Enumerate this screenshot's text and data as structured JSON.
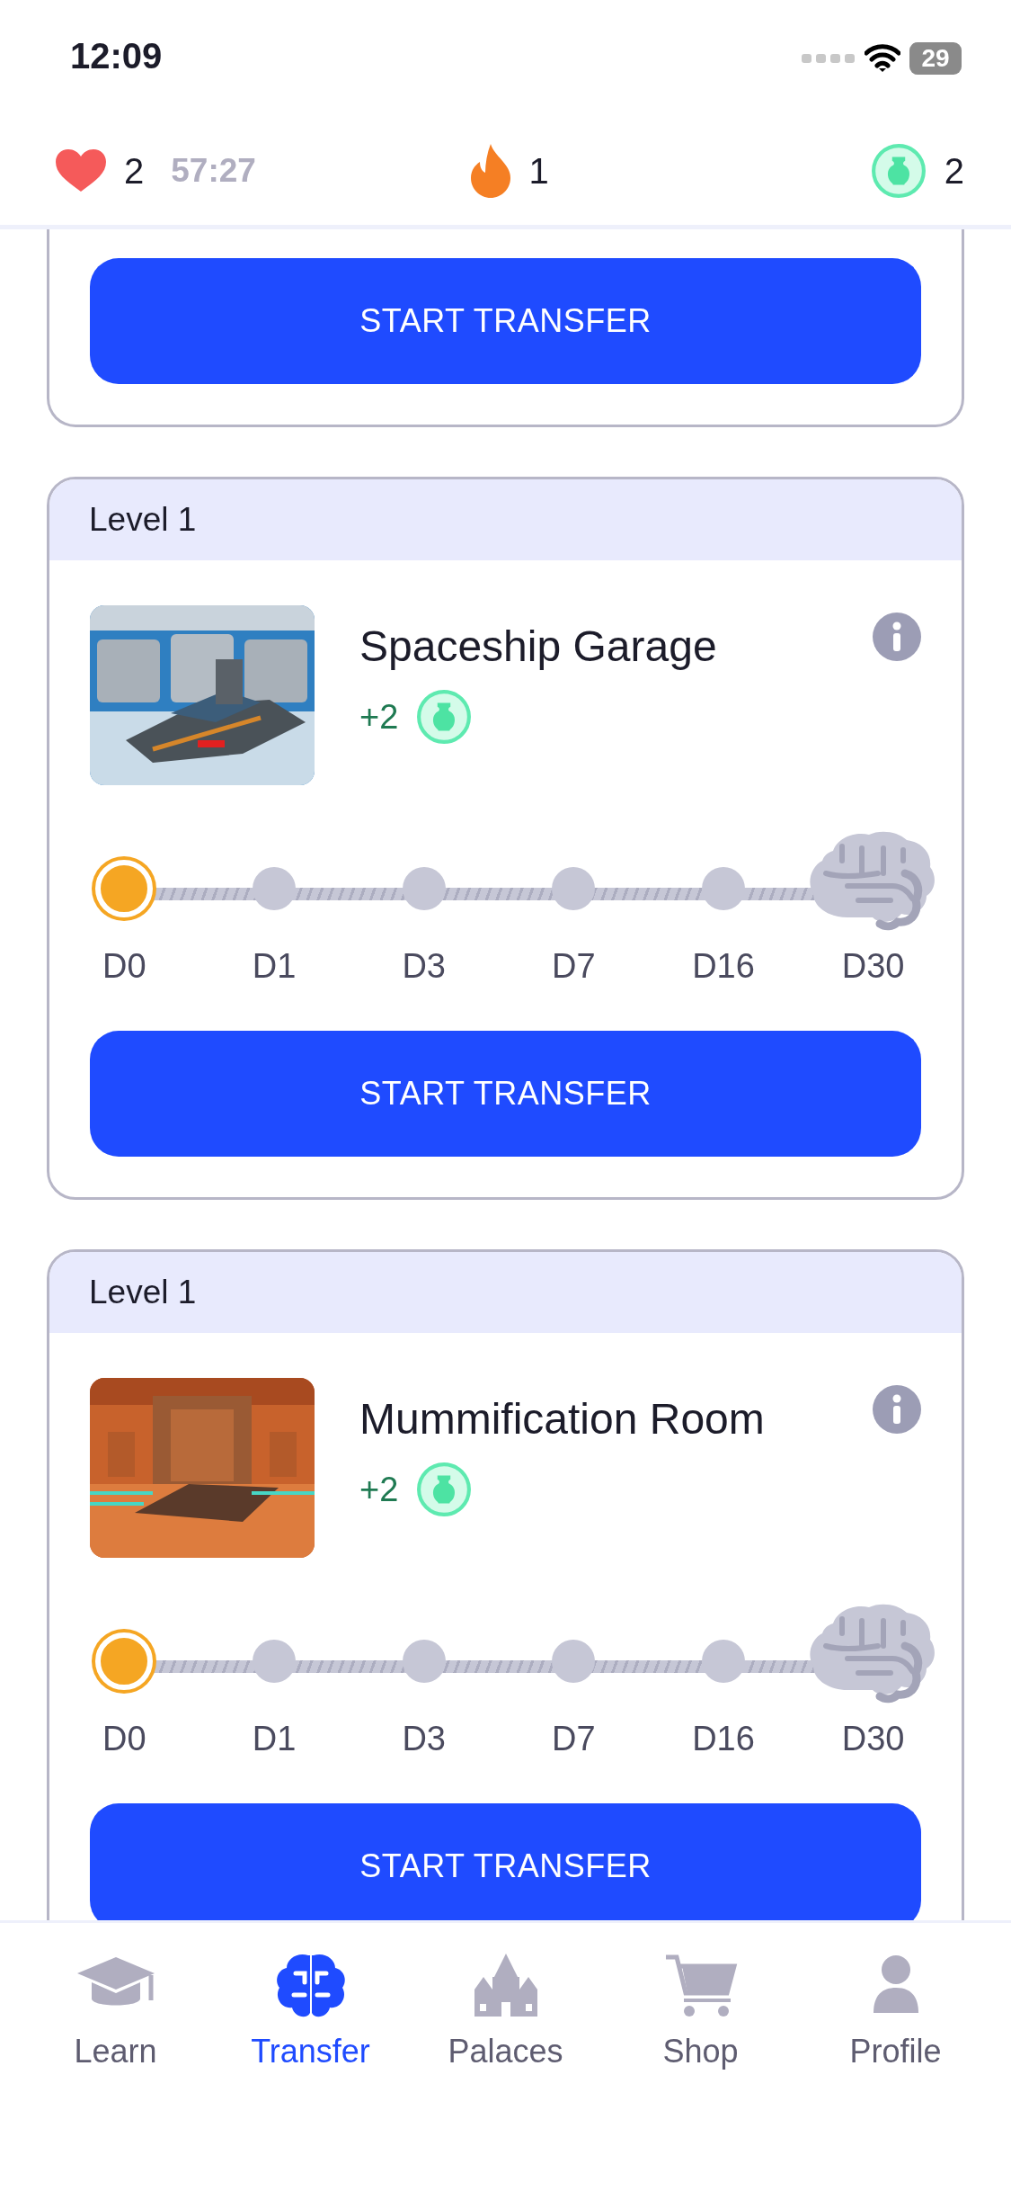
{
  "status_bar": {
    "time": "12:09",
    "battery": "29"
  },
  "header": {
    "lives": "2",
    "timer": "57:27",
    "streak": "1",
    "gems": "2"
  },
  "cards": [
    {
      "kind": "partial",
      "button": "START TRANSFER"
    },
    {
      "kind": "full",
      "level": "Level 1",
      "title": "Spaceship Garage",
      "reward": "+2",
      "button": "START TRANSFER",
      "milestones": [
        {
          "label": "D0",
          "kind": "dot",
          "done": true
        },
        {
          "label": "D1",
          "kind": "dot",
          "done": false
        },
        {
          "label": "D3",
          "kind": "dot",
          "done": false
        },
        {
          "label": "D7",
          "kind": "dot",
          "done": false
        },
        {
          "label": "D16",
          "kind": "dot",
          "done": false
        },
        {
          "label": "D30",
          "kind": "brain",
          "done": false
        }
      ]
    },
    {
      "kind": "full",
      "level": "Level 1",
      "title": "Mummification Room",
      "reward": "+2",
      "button": "START TRANSFER",
      "milestones": [
        {
          "label": "D0",
          "kind": "dot",
          "done": true
        },
        {
          "label": "D1",
          "kind": "dot",
          "done": false
        },
        {
          "label": "D3",
          "kind": "dot",
          "done": false
        },
        {
          "label": "D7",
          "kind": "dot",
          "done": false
        },
        {
          "label": "D16",
          "kind": "dot",
          "done": false
        },
        {
          "label": "D30",
          "kind": "brain",
          "done": false
        }
      ]
    }
  ],
  "nav": [
    {
      "label": "Learn",
      "selected": false
    },
    {
      "label": "Transfer",
      "selected": true
    },
    {
      "label": "Palaces",
      "selected": false
    },
    {
      "label": "Shop",
      "selected": false
    },
    {
      "label": "Profile",
      "selected": false
    }
  ]
}
